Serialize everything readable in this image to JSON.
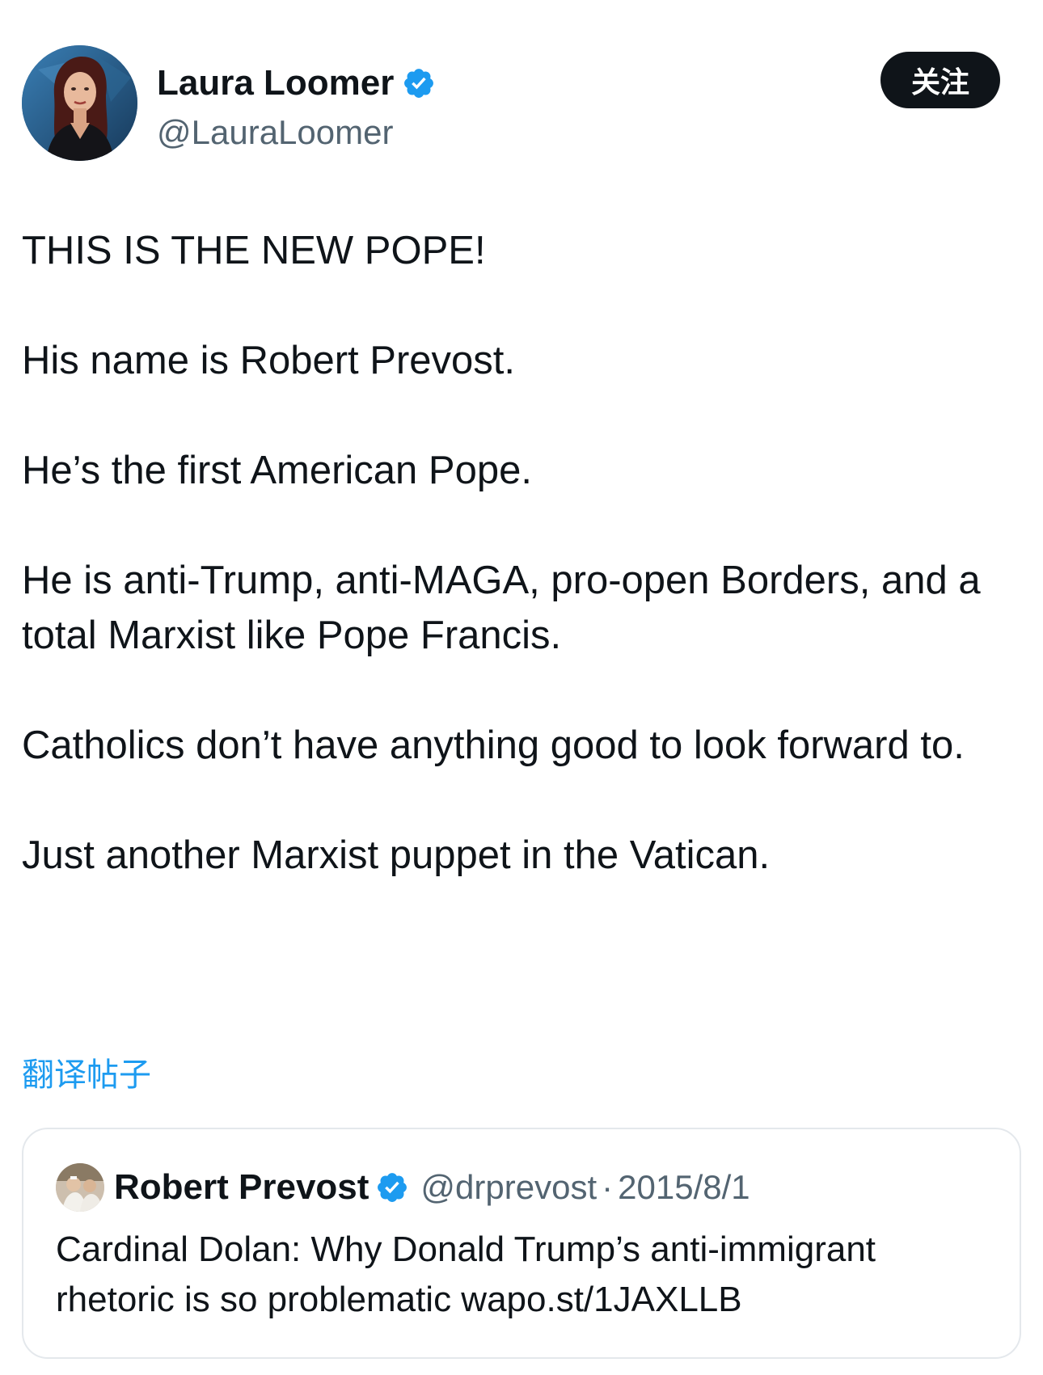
{
  "author": {
    "display_name": "Laura Loomer",
    "handle": "@LauraLoomer",
    "verified": true,
    "avatar_icon": "profile-photo"
  },
  "follow_button": {
    "label": "关注"
  },
  "tweet": {
    "paragraphs": [
      "THIS IS THE NEW POPE!",
      "His name is Robert Prevost.",
      "He’s the first American Pope.",
      "He is anti-Trump, anti-MAGA, pro-open Borders, and a total Marxist like Pope Francis.",
      "Catholics don’t have anything good to look forward to.",
      "Just another Marxist puppet in the Vatican."
    ]
  },
  "translate_link": {
    "label": "翻译帖子"
  },
  "quoted_tweet": {
    "display_name": "Robert Prevost",
    "verified": true,
    "handle": "@drprevost",
    "separator": "·",
    "date": "2015/8/1",
    "text": "Cardinal Dolan: Why Donald Trump’s anti-immigrant rhetoric is so problematic wapo.st/1JAXLLB"
  },
  "colors": {
    "text_primary": "#0f1419",
    "text_secondary": "#536471",
    "verified_blue": "#1d9bf0",
    "link_blue": "#1d9bf0",
    "button_bg": "#0f1419",
    "card_border": "#e4e8ec"
  }
}
